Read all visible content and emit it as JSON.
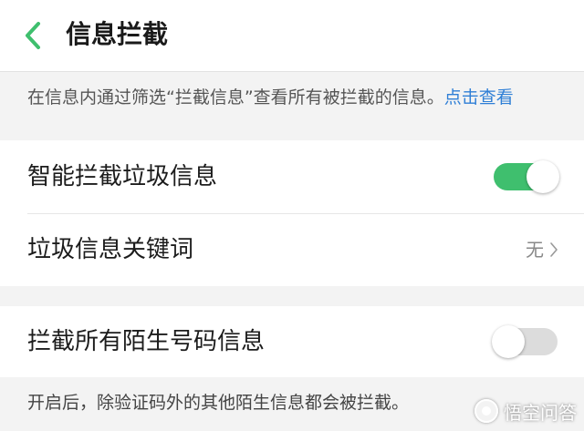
{
  "header": {
    "title": "信息拦截",
    "back_icon": "chevron-left-icon",
    "accent_color": "#3fbf6e"
  },
  "hint": {
    "text": "在信息内通过筛选“拦截信息”查看所有被拦截的信息。",
    "link_text": "点击查看",
    "link_color": "#2f7fd6"
  },
  "settings": {
    "smart_block": {
      "label": "智能拦截垃圾信息",
      "enabled": true
    },
    "spam_keywords": {
      "label": "垃圾信息关键词",
      "value": "无",
      "chevron_icon": "chevron-right-icon"
    },
    "block_strangers": {
      "label": "拦截所有陌生号码信息",
      "enabled": false
    }
  },
  "note": {
    "text": "开启后，除验证码外的其他陌生信息都会被拦截。"
  },
  "watermark": {
    "text": "悟空问答"
  }
}
